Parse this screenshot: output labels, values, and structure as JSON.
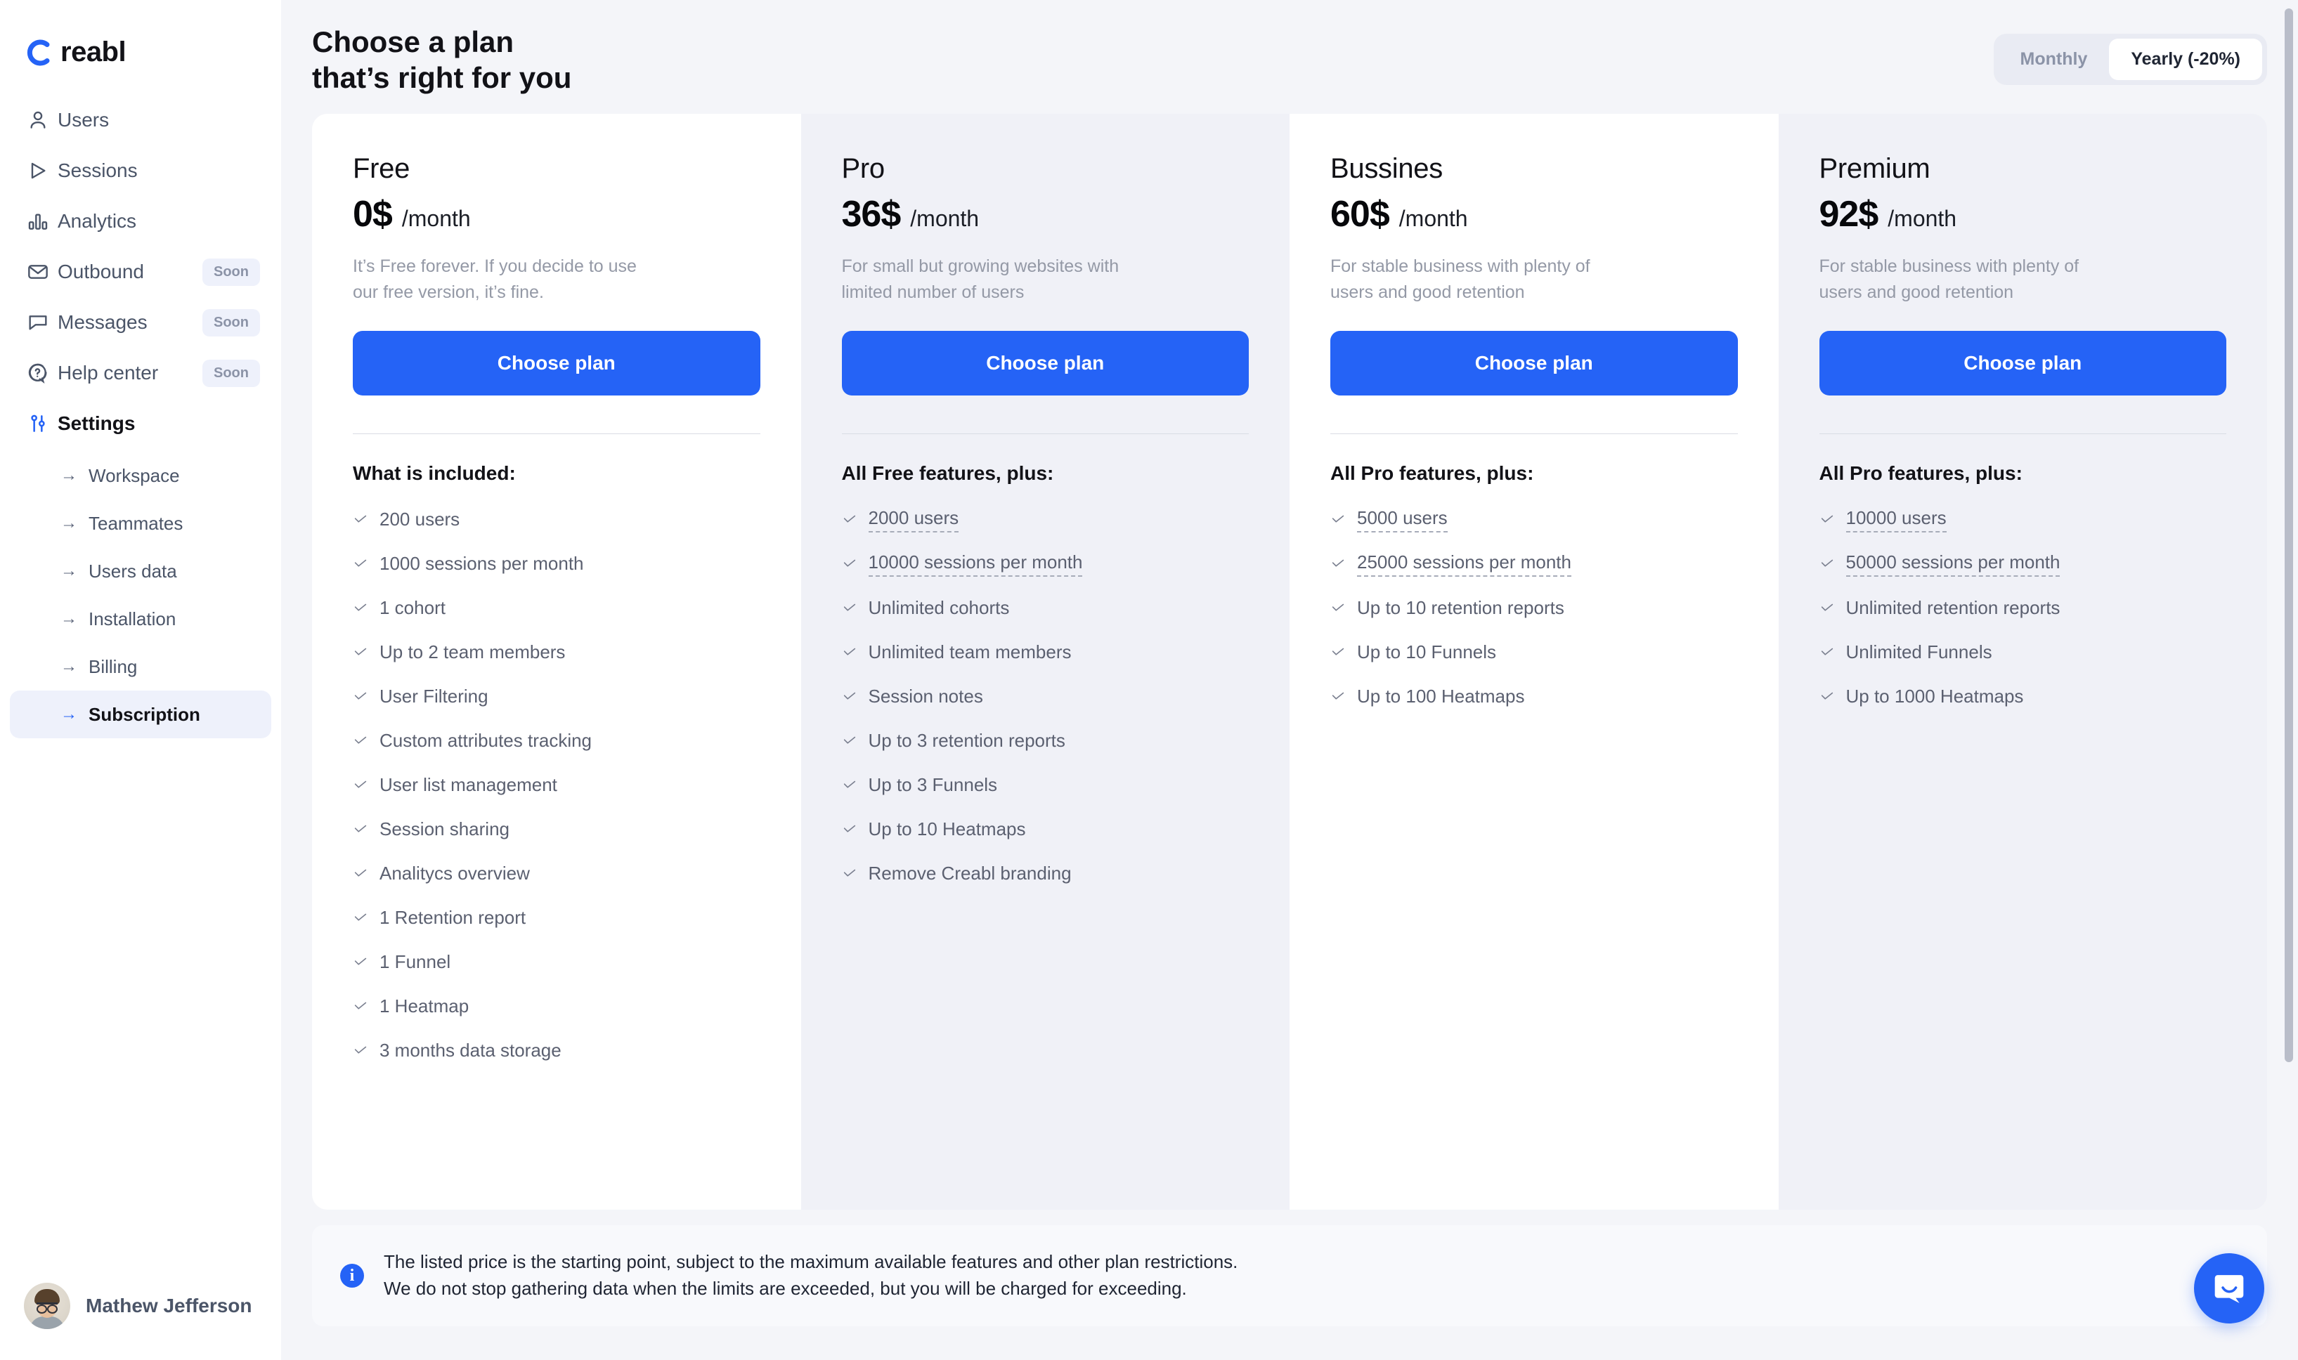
{
  "brand": {
    "name": "reabl",
    "accent": "#2563f6"
  },
  "sidebar": {
    "nav": [
      {
        "label": "Users",
        "icon": "user-icon",
        "badge": ""
      },
      {
        "label": "Sessions",
        "icon": "play-icon",
        "badge": ""
      },
      {
        "label": "Analytics",
        "icon": "bar-chart-icon",
        "badge": ""
      },
      {
        "label": "Outbound",
        "icon": "mail-icon",
        "badge": "Soon"
      },
      {
        "label": "Messages",
        "icon": "chat-icon",
        "badge": "Soon"
      },
      {
        "label": "Help center",
        "icon": "question-icon",
        "badge": "Soon"
      },
      {
        "label": "Settings",
        "icon": "sliders-icon",
        "badge": ""
      }
    ],
    "subnav": [
      {
        "label": "Workspace"
      },
      {
        "label": "Teammates"
      },
      {
        "label": "Users data"
      },
      {
        "label": "Installation"
      },
      {
        "label": "Billing"
      },
      {
        "label": "Subscription"
      }
    ],
    "profile": {
      "name": "Mathew Jefferson",
      "avatar": "user-avatar"
    }
  },
  "header": {
    "title_line1": "Choose a plan",
    "title_line2": "that’s right for you",
    "billing_toggle": {
      "monthly": "Monthly",
      "yearly": "Yearly (-20%)",
      "selected": "Yearly (-20%)"
    }
  },
  "plans": [
    {
      "name": "Free",
      "price": "0$",
      "period": "/month",
      "description": "It’s Free forever. If you decide to use our free version, it’s fine.",
      "cta": "Choose plan",
      "features_title": "What is included:",
      "features": [
        {
          "text": "200 users",
          "link": false
        },
        {
          "text": "1000 sessions per month",
          "link": false
        },
        {
          "text": "1 cohort",
          "link": false
        },
        {
          "text": "Up to 2 team members",
          "link": false
        },
        {
          "text": "User Filtering",
          "link": false
        },
        {
          "text": "Custom attributes tracking",
          "link": false
        },
        {
          "text": "User list management",
          "link": false
        },
        {
          "text": "Session sharing",
          "link": false
        },
        {
          "text": "Analitycs overview",
          "link": false
        },
        {
          "text": "1 Retention report",
          "link": false
        },
        {
          "text": "1 Funnel",
          "link": false
        },
        {
          "text": "1 Heatmap",
          "link": false
        },
        {
          "text": "3 months data storage",
          "link": false
        }
      ]
    },
    {
      "name": "Pro",
      "price": "36$",
      "period": "/month",
      "description": "For small but growing websites with limited number of users",
      "cta": "Choose plan",
      "features_title": "All Free features, plus:",
      "features": [
        {
          "text": "2000 users",
          "link": true
        },
        {
          "text": "10000 sessions per month",
          "link": true
        },
        {
          "text": "Unlimited cohorts",
          "link": false
        },
        {
          "text": "Unlimited team members",
          "link": false
        },
        {
          "text": "Session notes",
          "link": false
        },
        {
          "text": "Up to 3 retention reports",
          "link": false
        },
        {
          "text": "Up to 3 Funnels",
          "link": false
        },
        {
          "text": "Up to 10 Heatmaps",
          "link": false
        },
        {
          "text": "Remove Creabl branding",
          "link": false
        }
      ]
    },
    {
      "name": "Bussines",
      "price": "60$",
      "period": "/month",
      "description": "For stable business with plenty of users and good retention",
      "cta": "Choose plan",
      "features_title": "All Pro features, plus:",
      "features": [
        {
          "text": "5000 users",
          "link": true
        },
        {
          "text": "25000 sessions per month",
          "link": true
        },
        {
          "text": "Up to 10 retention reports",
          "link": false
        },
        {
          "text": "Up to 10 Funnels",
          "link": false
        },
        {
          "text": "Up to 100 Heatmaps",
          "link": false
        }
      ]
    },
    {
      "name": "Premium",
      "price": "92$",
      "period": "/month",
      "description": "For stable business with plenty of users and good retention",
      "cta": "Choose plan",
      "features_title": "All Pro features, plus:",
      "features": [
        {
          "text": "10000 users",
          "link": true
        },
        {
          "text": "50000 sessions per month",
          "link": true
        },
        {
          "text": "Unlimited retention reports",
          "link": false
        },
        {
          "text": "Unlimited Funnels",
          "link": false
        },
        {
          "text": "Up to 1000 Heatmaps",
          "link": false
        }
      ]
    }
  ],
  "notice": {
    "icon": "info-icon",
    "line1": "The listed price is the starting point, subject to the maximum available features and other plan restrictions.",
    "line2": "We do not stop gathering data when the limits are exceeded, but you will be charged for exceeding."
  },
  "chat": {
    "icon": "chat-bubble-icon"
  }
}
